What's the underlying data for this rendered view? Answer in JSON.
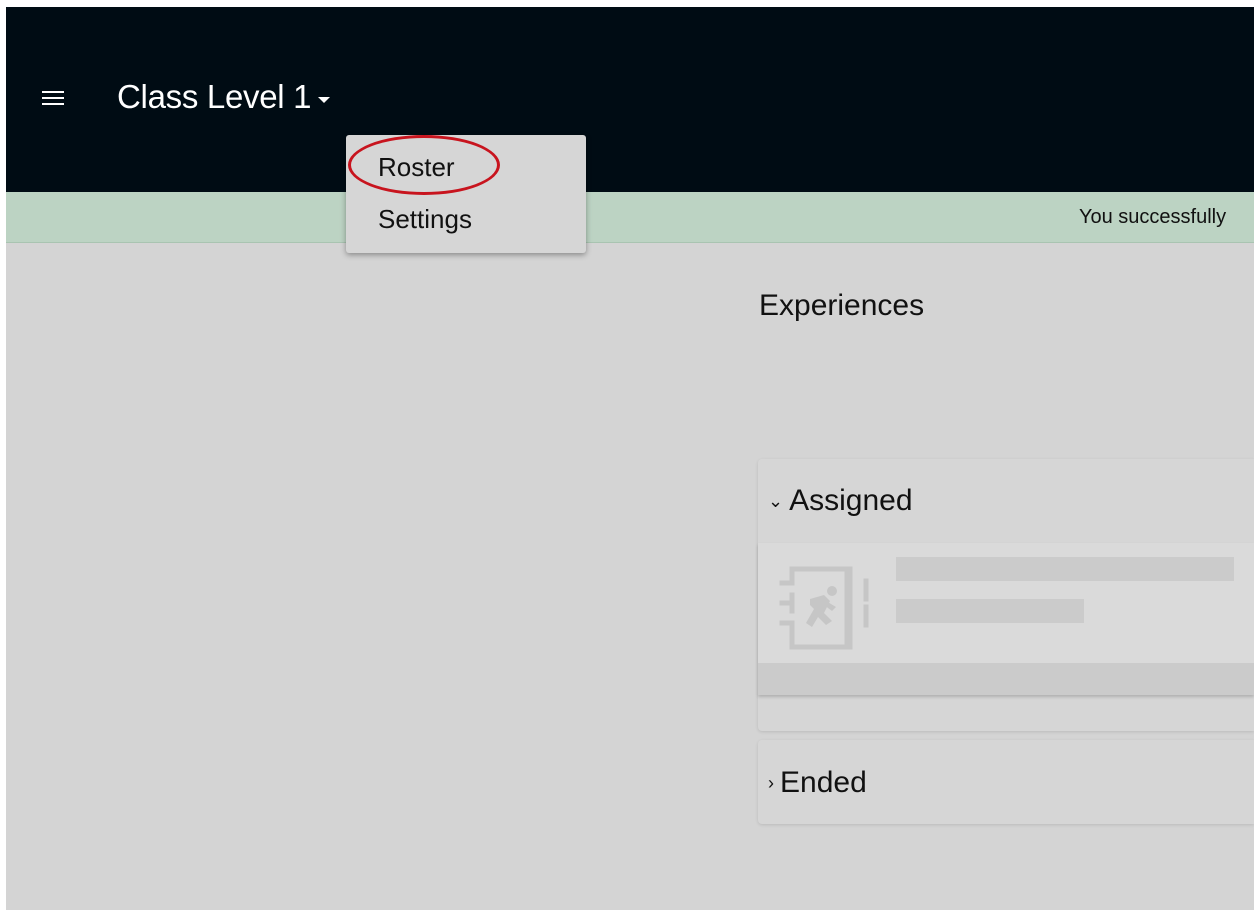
{
  "header": {
    "class_title": "Class Level 1",
    "menu_icon": "hamburger-menu-icon",
    "caret_icon": "caret-down-icon",
    "background_color": "#000c14"
  },
  "class_menu": {
    "items": [
      {
        "label": "Roster",
        "highlighted": true
      },
      {
        "label": "Settings",
        "highlighted": false
      }
    ],
    "highlight_color": "#c8141e"
  },
  "banner": {
    "text": "You successfully",
    "background_color": "#bcd3c3"
  },
  "main": {
    "title": "Experiences",
    "sections": [
      {
        "label": "Assigned",
        "chevron_icon": "chevron-down-icon",
        "expanded": true,
        "card_icon": "exit-door-running-person-icon",
        "loading": true
      },
      {
        "label": "Ended",
        "chevron_icon": "chevron-right-icon",
        "expanded": false
      }
    ]
  }
}
